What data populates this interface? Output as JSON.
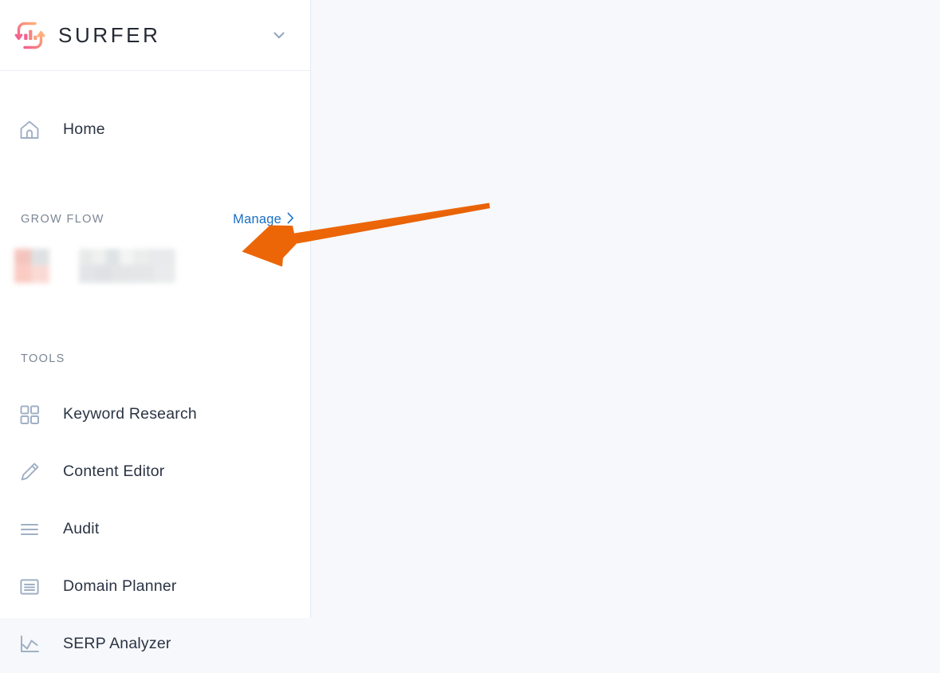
{
  "app": {
    "brand_name": "SURFER",
    "logo_icon": "surfer-bar-chart-refresh-logo",
    "logo_gradient_from": "#f2709c",
    "logo_gradient_to": "#ff9472",
    "header_chevron_icon": "chevron-down-icon"
  },
  "sidebar": {
    "primary": [
      {
        "label": "Home",
        "icon": "home-icon"
      }
    ],
    "grow_flow": {
      "title": "GROW FLOW",
      "manage_label": "Manage",
      "manage_chevron_icon": "chevron-right-icon",
      "items": [
        {
          "icon": "blurred-thumbnail-pink",
          "label": ""
        },
        {
          "icon": "blurred-text-placeholder",
          "label": ""
        }
      ]
    },
    "tools": {
      "title": "TOOLS",
      "items": [
        {
          "label": "Keyword Research",
          "icon": "grid-squares-icon"
        },
        {
          "label": "Content Editor",
          "icon": "pencil-icon"
        },
        {
          "label": "Audit",
          "icon": "hamburger-lines-icon"
        },
        {
          "label": "Domain Planner",
          "icon": "document-lines-icon"
        },
        {
          "label": "SERP Analyzer",
          "icon": "line-chart-icon"
        }
      ]
    }
  },
  "annotation": {
    "arrow_icon": "orange-pointer-arrow",
    "arrow_color": "#ec6608",
    "points_to": "GROW FLOW blurred items"
  },
  "colors": {
    "sidebar_background": "#ffffff",
    "main_background": "#f6f8fb",
    "text_primary": "#2b3444",
    "text_muted": "#7b8694",
    "link_blue": "#1a6fc4",
    "icon_gray": "#9fb0c4",
    "divider": "#e9eff5"
  }
}
